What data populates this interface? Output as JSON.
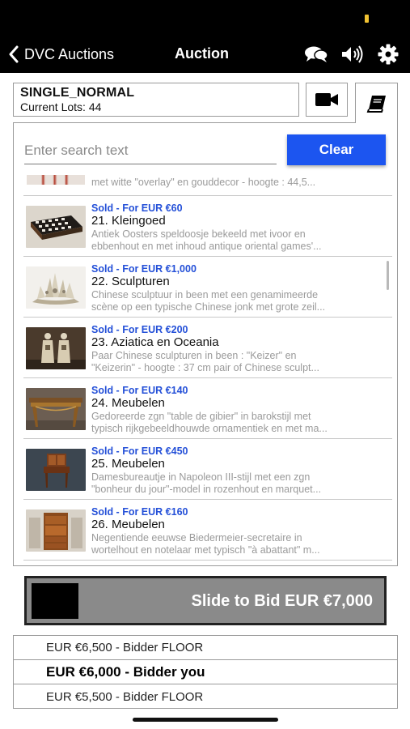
{
  "nav": {
    "back_label": "DVC Auctions",
    "title": "Auction",
    "icons": [
      "chat-icon",
      "speaker-icon",
      "gear-icon"
    ]
  },
  "auction": {
    "name": "SINGLE_NORMAL",
    "lots_label": "Current Lots: 44"
  },
  "header_buttons": [
    "video-camera-icon",
    "book-icon"
  ],
  "search": {
    "placeholder": "Enter search text",
    "value": "",
    "clear_label": "Clear"
  },
  "lots": {
    "partial_desc": "met witte \"overlay\" en gouddecor  -  hoogte : 44,5...",
    "items": [
      {
        "status": "Sold - For EUR €60",
        "title": "21. Kleingoed",
        "desc1": "Antiek Oosters speldoosje bekeeld met ivoor en",
        "desc2": "ebbenhout en met inhoud antique oriental games'..."
      },
      {
        "status": "Sold - For EUR €1,000",
        "title": "22. Sculpturen",
        "desc1": "Chinese sculptuur in been met een genamimeerde",
        "desc2": "scène op een typische Chinese jonk met grote zeil..."
      },
      {
        "status": "Sold - For EUR €200",
        "title": "23. Aziatica en Oceania",
        "desc1": "Paar Chinese sculpturen in been : \"Keizer\" en",
        "desc2": "\"Keizerin\"  -  hoogte : 37 cm pair of Chinese sculpt..."
      },
      {
        "status": "Sold - For EUR €140",
        "title": "24. Meubelen",
        "desc1": "Gedoreerde zgn \"table de gibier\" in barokstijl met",
        "desc2": "typisch rijkgebeeldhouwde ornamentiek en met ma..."
      },
      {
        "status": "Sold - For EUR €450",
        "title": "25. Meubelen",
        "desc1": "Damesbureautje in Napoleon III-stijl met een zgn",
        "desc2": "\"bonheur du jour\"-model in rozenhout en marquet..."
      },
      {
        "status": "Sold - For EUR €160",
        "title": "26. Meubelen",
        "desc1": "Negentiende eeuwse Biedermeier-secretaire in",
        "desc2": "wortelhout en notelaar met typisch \"à abattant\" m..."
      }
    ]
  },
  "slider": {
    "label": "Slide to Bid EUR €7,000"
  },
  "bids": [
    {
      "text": "EUR €6,500 - Bidder FLOOR",
      "mine": false
    },
    {
      "text": "EUR €6,000 - Bidder you",
      "mine": true
    },
    {
      "text": "EUR €5,500 - Bidder FLOOR",
      "mine": false
    }
  ],
  "colors": {
    "accent_blue": "#1c55f0",
    "sold_status": "#2450d8",
    "slider_bg": "#8a8a8a",
    "status_indicator": "#f1c232"
  }
}
